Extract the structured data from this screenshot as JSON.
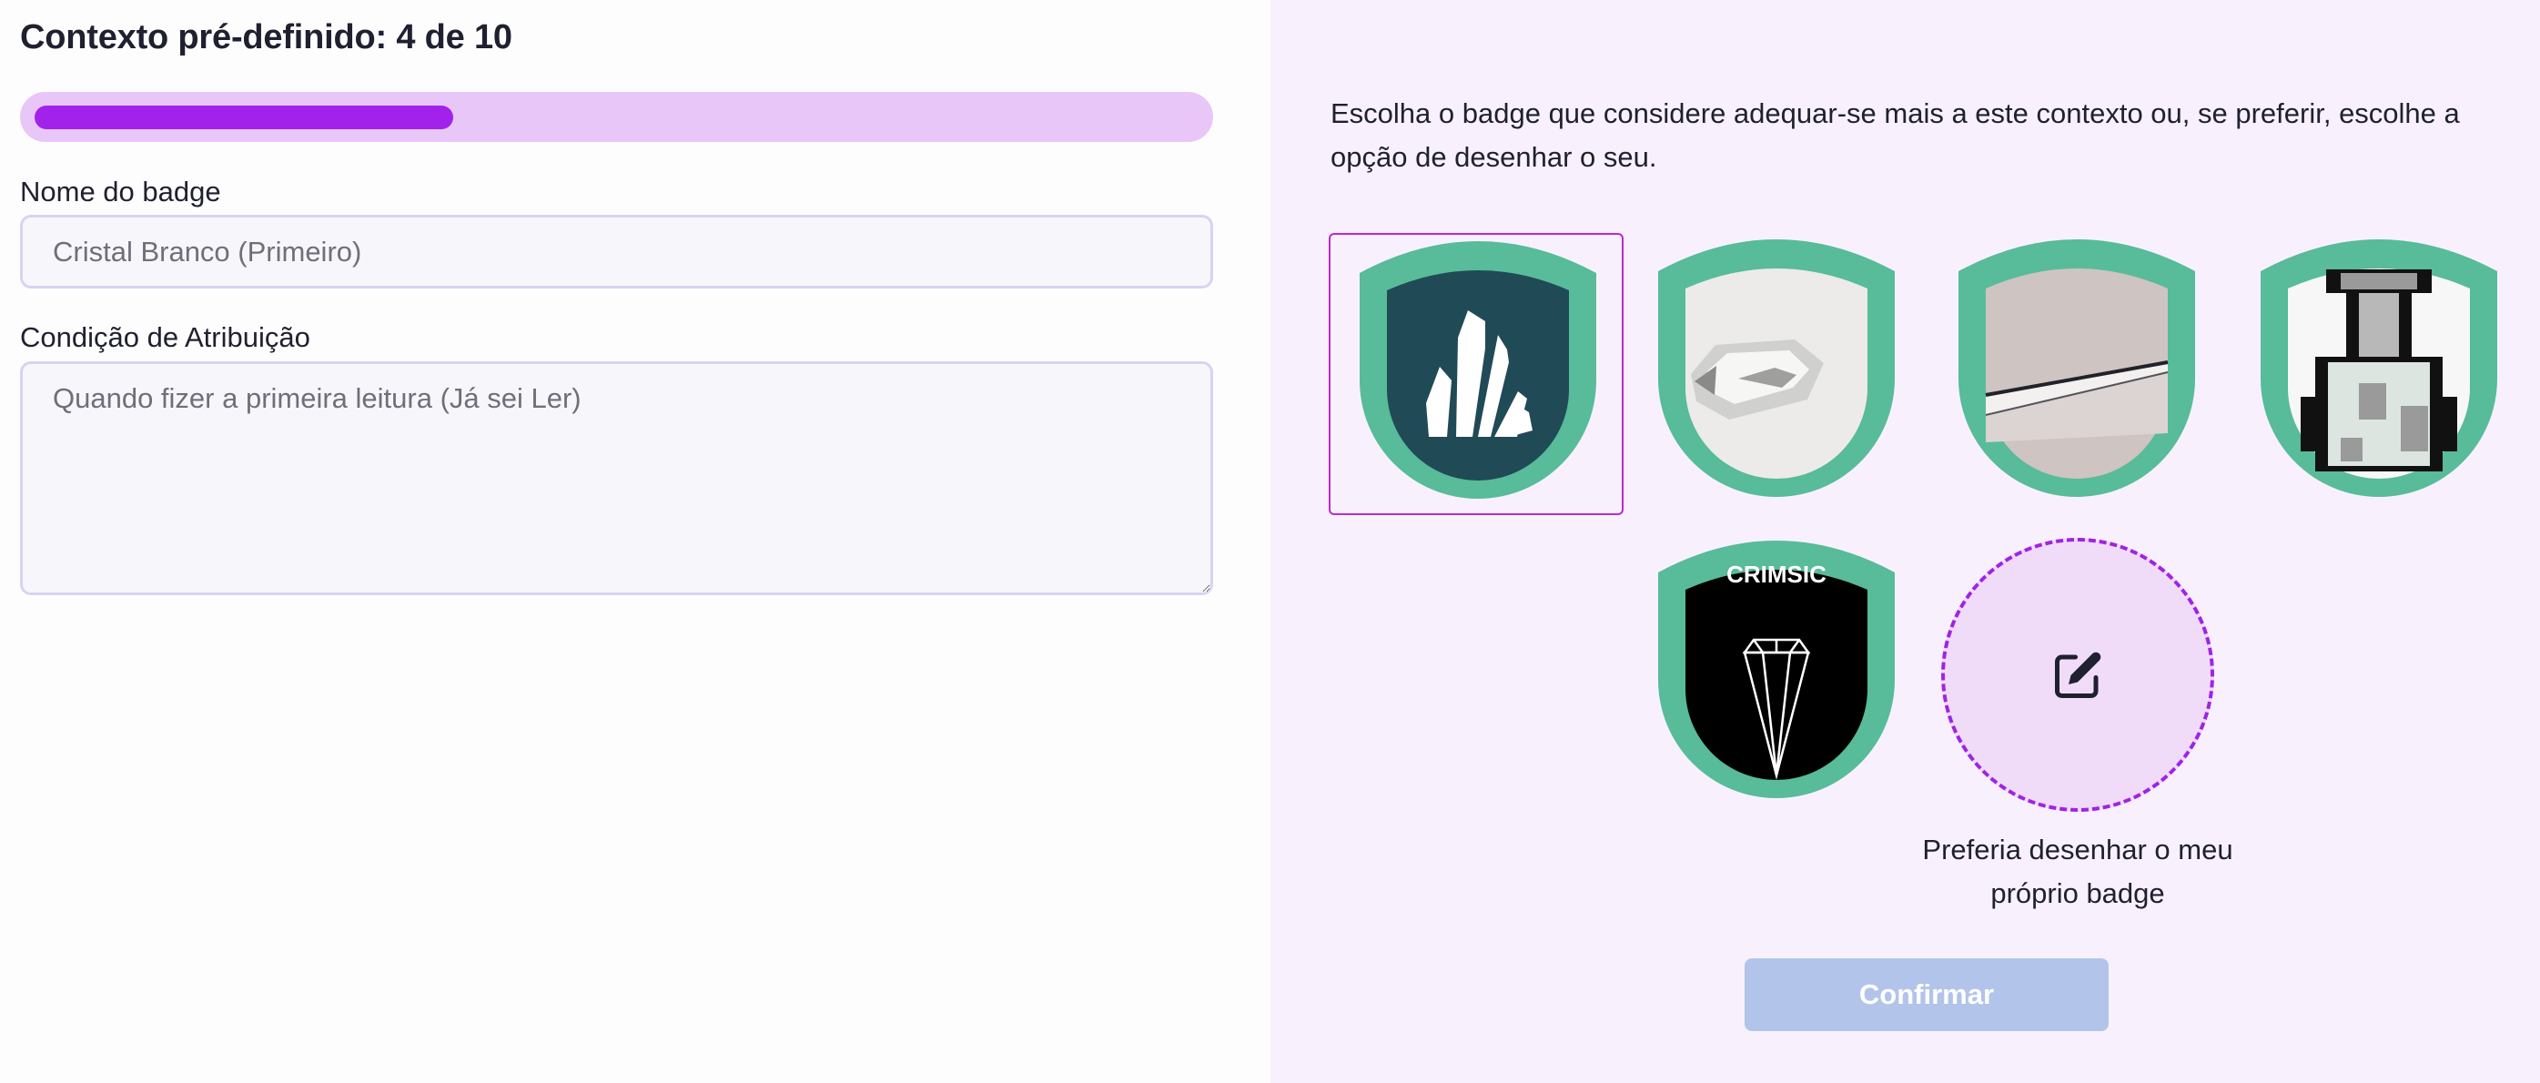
{
  "form": {
    "title": "Contexto pré-definido: 4 de 10",
    "progress": {
      "current": 4,
      "total": 10,
      "fraction": 0.36
    },
    "name_label": "Nome do badge",
    "name_placeholder": "Cristal Branco (Primeiro)",
    "condition_label": "Condição de Atribuição",
    "condition_placeholder": "Quando fizer a primeira leitura (Já sei Ler)"
  },
  "picker": {
    "description": "Escolha o badge que considere adequar-se mais a este contexto ou, se preferir, escolhe a opção de desenhar o seu.",
    "badges": [
      {
        "id": "crystal-cluster",
        "selected": true
      },
      {
        "id": "ice-crystal",
        "selected": false
      },
      {
        "id": "paper-fold",
        "selected": false
      },
      {
        "id": "pixel-bottle",
        "selected": false
      },
      {
        "id": "crimsic-diamond",
        "selected": false,
        "text": "CRIMSIC"
      }
    ],
    "draw_own_label": "Preferia desenhar o meu próprio badge",
    "draw_icon": "edit-icon"
  },
  "actions": {
    "confirm_label": "Confirmar"
  },
  "colors": {
    "accent": "#a222ec",
    "progress_track": "#e8c7f8",
    "badge_frame": "#58bb9a",
    "selection_border": "#c026d3",
    "confirm_disabled": "#b2c4e9",
    "right_panel_bg": "#f8f1fd"
  }
}
